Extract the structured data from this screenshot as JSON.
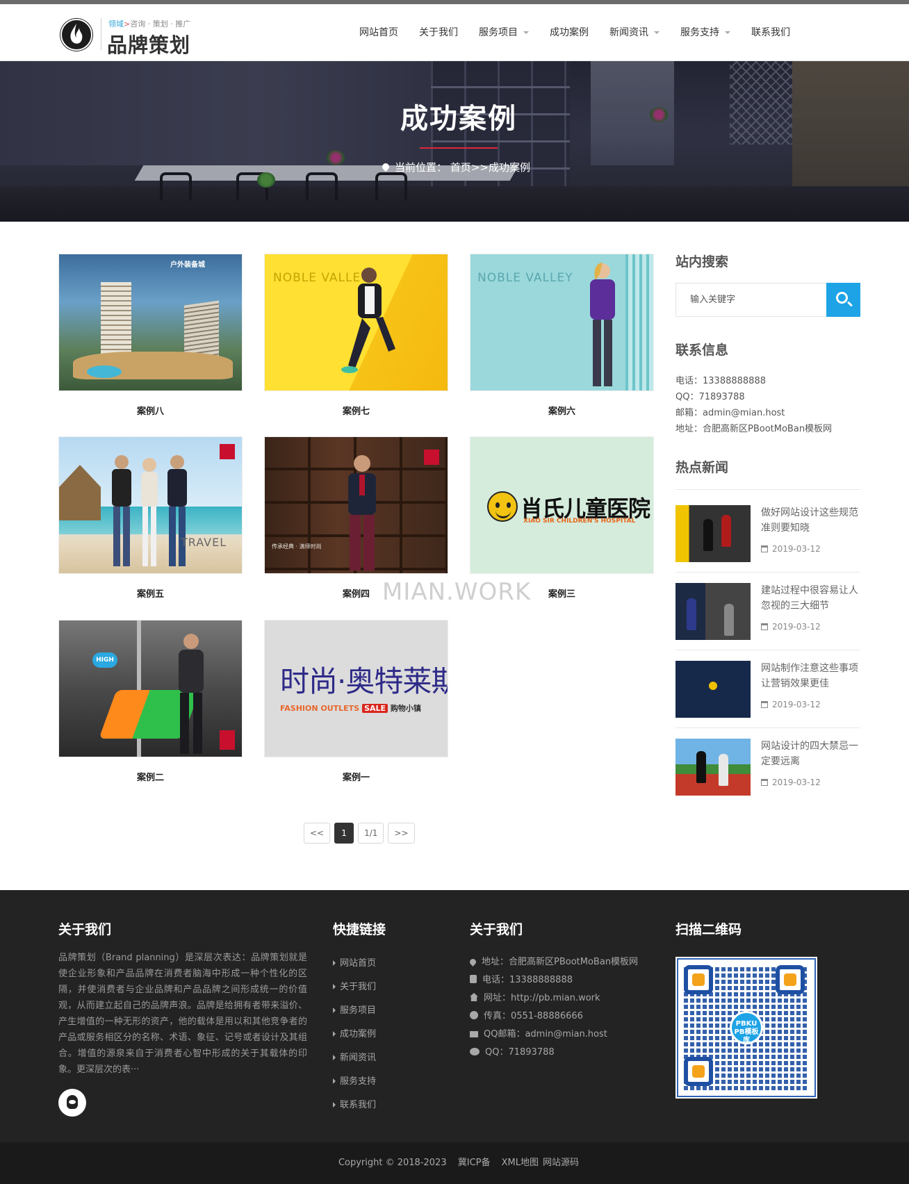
{
  "header": {
    "logo_slogan_accent": "领域",
    "logo_slogan_rest": "咨询 · 策划 · 推广",
    "logo_name": "品牌策划"
  },
  "nav": {
    "items": [
      {
        "label": "网站首页",
        "dropdown": false
      },
      {
        "label": "关于我们",
        "dropdown": false
      },
      {
        "label": "服务项目",
        "dropdown": true
      },
      {
        "label": "成功案例",
        "dropdown": false
      },
      {
        "label": "新闻资讯",
        "dropdown": true
      },
      {
        "label": "服务支持",
        "dropdown": true
      },
      {
        "label": "联系我们",
        "dropdown": false
      }
    ]
  },
  "banner": {
    "title": "成功案例",
    "breadcrumb_prefix": "当前位置：",
    "breadcrumb_home": "首页",
    "breadcrumb_sep": ">>",
    "breadcrumb_current": "成功案例"
  },
  "cases": [
    {
      "title": "案例八",
      "image_text": "户外装备城"
    },
    {
      "title": "案例七",
      "image_text": "NOBLE VALLEY"
    },
    {
      "title": "案例六",
      "image_text": "NOBLE VALLEY"
    },
    {
      "title": "案例五",
      "image_text": "TRAVEL"
    },
    {
      "title": "案例四",
      "image_text": "传承经典 · 演绎时尚"
    },
    {
      "title": "案例三",
      "image_text": "肖氏儿童医院",
      "image_sub": "XIAO SIR CHILDREN'S HOSPITAL"
    },
    {
      "title": "案例二",
      "image_text": "HIGH"
    },
    {
      "title": "案例一",
      "image_text": "时尚·奥特莱斯",
      "image_sub": "FASHION OUTLETS",
      "image_sale": "SALE",
      "image_shop": "购物小镇"
    }
  ],
  "watermark": "MIAN.WORK",
  "pagination": {
    "prev": "<<",
    "current": "1",
    "info": "1/1",
    "next": ">>"
  },
  "sidebar": {
    "search_heading": "站内搜索",
    "search_placeholder": "输入关键字",
    "contact_heading": "联系信息",
    "contact": {
      "phone": "电话：13388888888",
      "qq": "QQ：71893788",
      "email": "邮箱：admin@mian.host",
      "address": "地址：合肥高新区PBootMoBan模板网"
    },
    "news_heading": "热点新闻",
    "news": [
      {
        "title": "做好网站设计这些规范准则要知晓",
        "date": "2019-03-12"
      },
      {
        "title": "建站过程中很容易让人忽视的三大细节",
        "date": "2019-03-12"
      },
      {
        "title": "网站制作注意这些事项让营销效果更佳",
        "date": "2019-03-12"
      },
      {
        "title": "网站设计的四大禁忌一定要远离",
        "date": "2019-03-12"
      }
    ]
  },
  "footer": {
    "about_heading": "关于我们",
    "about_text": "品牌策划（Brand planning）是深层次表达：品牌策划就是使企业形象和产品品牌在消费者脑海中形成一种个性化的区隔，并使消费者与企业品牌和产品品牌之间形成统一的价值观，从而建立起自己的品牌声浪。品牌是给拥有者带来溢价、产生增值的一种无形的资产，他的载体是用以和其他竞争者的产品或服务相区分的名称、术语、象征、记号或者设计及其组合。增值的源泉来自于消费者心智中形成的关于其载体的印象。更深层次的表···",
    "links_heading": "快捷链接",
    "links": [
      "网站首页",
      "关于我们",
      "服务项目",
      "成功案例",
      "新闻资讯",
      "服务支持",
      "联系我们"
    ],
    "contact_heading": "关于我们",
    "contact": [
      {
        "icon": "map-pin-icon",
        "text": "地址：合肥高新区PBootMoBan模板网"
      },
      {
        "icon": "phone-icon",
        "text": "电话：13388888888"
      },
      {
        "icon": "home-icon",
        "text": "网址：http://pb.mian.work"
      },
      {
        "icon": "globe-icon",
        "text": "传真：0551-88886666"
      },
      {
        "icon": "mail-icon",
        "text": "QQ邮箱：admin@mian.host"
      },
      {
        "icon": "wechat-icon",
        "text": "QQ：71893788"
      }
    ],
    "qr_heading": "扫描二维码",
    "qr_center_line1": "PBKU",
    "qr_center_line2": "PB模板库",
    "copyright": "Copyright © 2018-2023",
    "icp": "冀ICP备",
    "sitemap": "XML地图",
    "source": "网站源码"
  },
  "colors": {
    "accent_blue": "#1ea3e6",
    "underline_red": "#e0263c",
    "footer_bg": "#232323",
    "copyright_bg": "#1a1a1a"
  }
}
